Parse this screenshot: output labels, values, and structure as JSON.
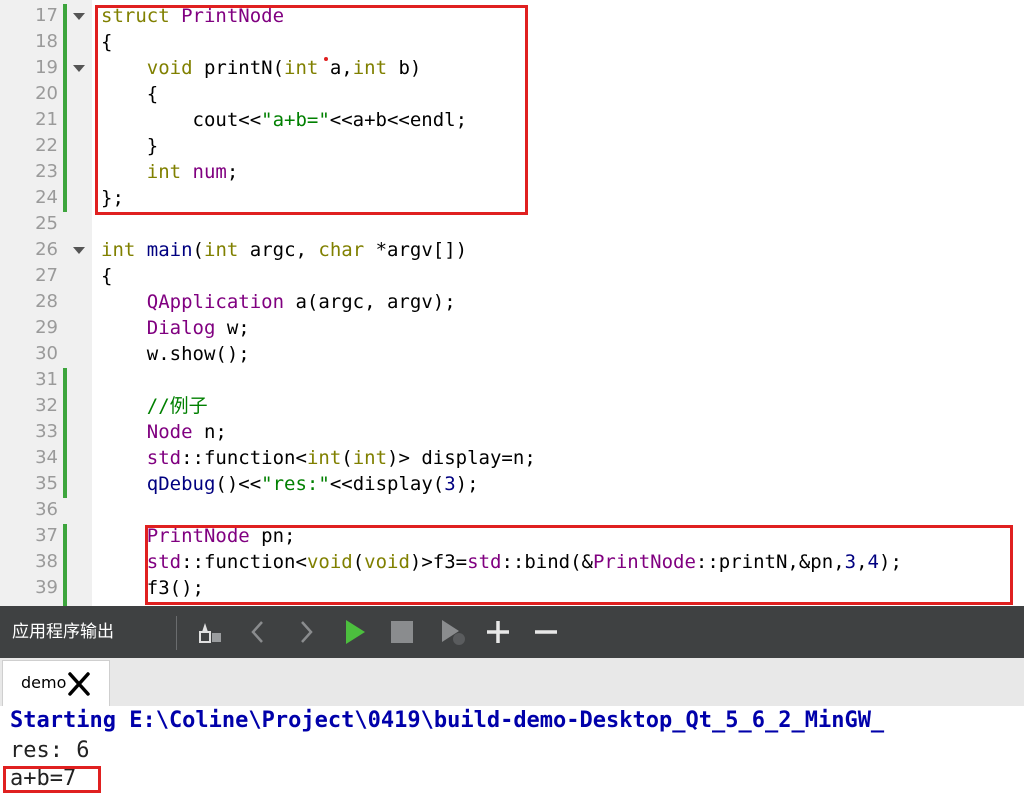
{
  "editor": {
    "line_numbers": [
      "17",
      "18",
      "19",
      "20",
      "21",
      "22",
      "23",
      "24",
      "25",
      "26",
      "27",
      "28",
      "29",
      "30",
      "31",
      "32",
      "33",
      "34",
      "35",
      "36",
      "37",
      "38",
      "39"
    ],
    "lines": [
      [
        {
          "c": "k",
          "t": "struct"
        },
        {
          "c": "p",
          "t": " "
        },
        {
          "c": "t",
          "t": "PrintNode"
        }
      ],
      [
        {
          "c": "p",
          "t": "{"
        }
      ],
      [
        {
          "c": "p",
          "t": "    "
        },
        {
          "c": "k",
          "t": "void"
        },
        {
          "c": "p",
          "t": " printN("
        },
        {
          "c": "k",
          "t": "int"
        },
        {
          "c": "p",
          "t": " a,"
        },
        {
          "c": "k",
          "t": "int"
        },
        {
          "c": "p",
          "t": " b)"
        }
      ],
      [
        {
          "c": "p",
          "t": "    {"
        }
      ],
      [
        {
          "c": "p",
          "t": "        cout<<"
        },
        {
          "c": "s",
          "t": "\"a+b=\""
        },
        {
          "c": "p",
          "t": "<<a+b<<endl;"
        }
      ],
      [
        {
          "c": "p",
          "t": "    }"
        }
      ],
      [
        {
          "c": "p",
          "t": "    "
        },
        {
          "c": "k",
          "t": "int"
        },
        {
          "c": "p",
          "t": " "
        },
        {
          "c": "t",
          "t": "num"
        },
        {
          "c": "p",
          "t": ";"
        }
      ],
      [
        {
          "c": "p",
          "t": "};"
        }
      ],
      [],
      [
        {
          "c": "k",
          "t": "int"
        },
        {
          "c": "p",
          "t": " "
        },
        {
          "c": "n",
          "t": "main"
        },
        {
          "c": "p",
          "t": "("
        },
        {
          "c": "k",
          "t": "int"
        },
        {
          "c": "p",
          "t": " argc, "
        },
        {
          "c": "k",
          "t": "char"
        },
        {
          "c": "p",
          "t": " *argv[])"
        }
      ],
      [
        {
          "c": "p",
          "t": "{"
        }
      ],
      [
        {
          "c": "p",
          "t": "    "
        },
        {
          "c": "t",
          "t": "QApplication"
        },
        {
          "c": "p",
          "t": " a(argc, argv);"
        }
      ],
      [
        {
          "c": "p",
          "t": "    "
        },
        {
          "c": "t",
          "t": "Dialog"
        },
        {
          "c": "p",
          "t": " w;"
        }
      ],
      [
        {
          "c": "p",
          "t": "    w.show();"
        }
      ],
      [],
      [
        {
          "c": "p",
          "t": "    "
        },
        {
          "c": "c",
          "t": "//例子"
        }
      ],
      [
        {
          "c": "p",
          "t": "    "
        },
        {
          "c": "t",
          "t": "Node"
        },
        {
          "c": "p",
          "t": " n;"
        }
      ],
      [
        {
          "c": "p",
          "t": "    "
        },
        {
          "c": "t",
          "t": "std"
        },
        {
          "c": "p",
          "t": "::function<"
        },
        {
          "c": "k",
          "t": "int"
        },
        {
          "c": "p",
          "t": "("
        },
        {
          "c": "k",
          "t": "int"
        },
        {
          "c": "p",
          "t": ")> display=n;"
        }
      ],
      [
        {
          "c": "p",
          "t": "    "
        },
        {
          "c": "n",
          "t": "qDebug"
        },
        {
          "c": "p",
          "t": "()<<"
        },
        {
          "c": "s",
          "t": "\"res:\""
        },
        {
          "c": "p",
          "t": "<<display("
        },
        {
          "c": "n",
          "t": "3"
        },
        {
          "c": "p",
          "t": ");"
        }
      ],
      [],
      [
        {
          "c": "p",
          "t": "    "
        },
        {
          "c": "t",
          "t": "PrintNode"
        },
        {
          "c": "p",
          "t": " pn;"
        }
      ],
      [
        {
          "c": "p",
          "t": "    "
        },
        {
          "c": "t",
          "t": "std"
        },
        {
          "c": "p",
          "t": "::function<"
        },
        {
          "c": "k",
          "t": "void"
        },
        {
          "c": "p",
          "t": "("
        },
        {
          "c": "k",
          "t": "void"
        },
        {
          "c": "p",
          "t": ")>f3="
        },
        {
          "c": "t",
          "t": "std"
        },
        {
          "c": "p",
          "t": "::bind(&"
        },
        {
          "c": "t",
          "t": "PrintNode"
        },
        {
          "c": "p",
          "t": "::printN,&pn,"
        },
        {
          "c": "n",
          "t": "3"
        },
        {
          "c": "p",
          "t": ","
        },
        {
          "c": "n",
          "t": "4"
        },
        {
          "c": "p",
          "t": ");"
        }
      ],
      [
        {
          "c": "p",
          "t": "    f3();"
        }
      ]
    ]
  },
  "output_pane": {
    "title": "应用程序输出",
    "toolbar_icons": [
      "clean-broom-icon",
      "previous-arrow-icon",
      "next-arrow-icon",
      "run-icon",
      "stop-icon",
      "attach-debugger-icon",
      "zoom-in-icon",
      "zoom-out-icon"
    ],
    "tab": {
      "label": "demo",
      "close_icon": "close-icon"
    },
    "lines": {
      "starting": "Starting E:\\Coline\\Project\\0419\\build-demo-Desktop_Qt_5_6_2_MinGW_",
      "res": "res: 6",
      "sum": "a+b=7"
    }
  },
  "colors": {
    "keyword": "#808000",
    "type": "#800080",
    "string": "#008000",
    "number_function": "#000080",
    "annotation_red": "#e02020",
    "change_bar_green": "#3da53d",
    "toolbar_bg": "#3f4142",
    "output_starting_blue": "#0000aa"
  }
}
